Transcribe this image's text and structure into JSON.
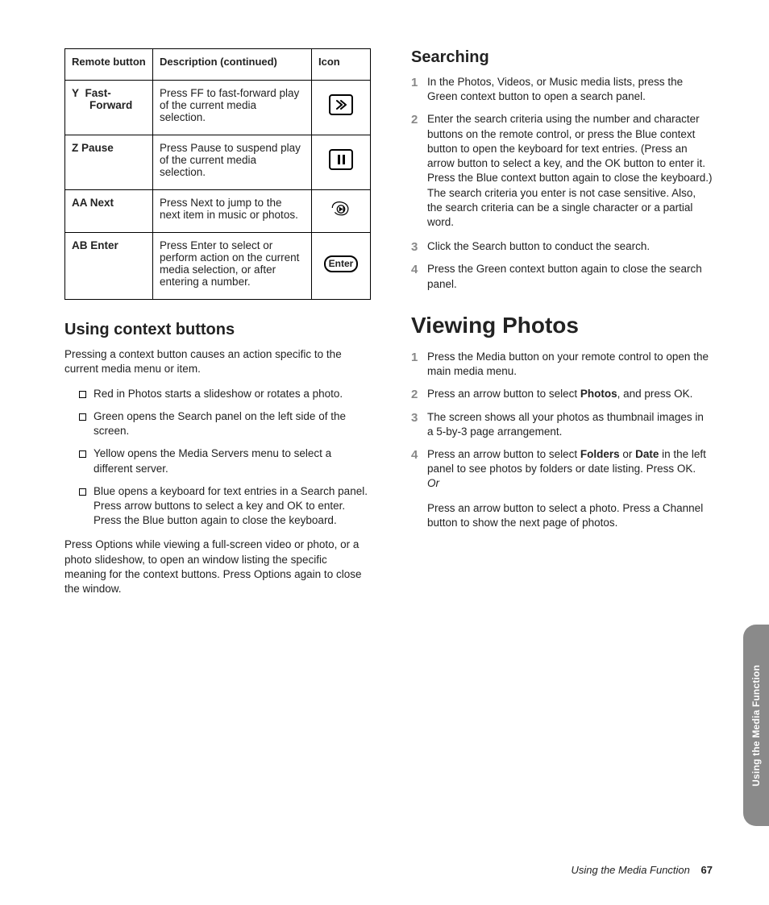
{
  "table": {
    "headers": {
      "col1": "Remote button",
      "col2": "Description (continued)",
      "col3": "Icon"
    },
    "rows": [
      {
        "btn_pre": "Y",
        "btn": "Fast-Forward",
        "desc": "Press FF to fast-forward play of the current media selection.",
        "icon": "ff"
      },
      {
        "btn_pre": "Z",
        "btn": "Pause",
        "desc": "Press Pause to suspend play of the current media selection.",
        "icon": "pause"
      },
      {
        "btn_pre": "AA",
        "btn": "Next",
        "desc": "Press Next to jump to the next item in music or photos.",
        "icon": "next"
      },
      {
        "btn_pre": "AB",
        "btn": "Enter",
        "desc": "Press Enter to select or perform action on the current media selection, or after entering a number.",
        "icon": "enter",
        "icon_label": "Enter"
      }
    ]
  },
  "left": {
    "h_context": "Using context buttons",
    "p_context_intro": "Pressing a context button causes an action specific to the current media menu or item.",
    "context_items": [
      "Red in Photos starts a slideshow or rotates a photo.",
      "Green opens the Search panel on the left side of the screen.",
      "Yellow opens the Media Servers menu to select a different server.",
      "Blue opens a keyboard for text entries in a Search panel. Press arrow buttons to select a key and OK to enter. Press the Blue button again to close the keyboard."
    ],
    "p_context_outro": "Press Options while viewing a full-screen video or photo, or a photo slideshow, to open an window listing the specific meaning for the context buttons. Press Options again to close the window."
  },
  "right": {
    "h_search": "Searching",
    "search_steps": [
      "In the Photos, Videos, or Music media lists, press the Green context button to open a search panel.",
      "Enter the search criteria using the number and character buttons on the remote control, or press the Blue context button to open the keyboard for text entries. (Press an arrow button to select a key, and the OK button to enter it. Press the Blue context button again to close the keyboard.)",
      "Click the Search button to conduct the search.",
      "Press the Green context button again to close the search panel."
    ],
    "search_sub_after_2": "The search criteria you enter is not case sensitive. Also, the search criteria can be a single character or a partial word.",
    "h_viewing": "Viewing Photos",
    "view_steps_1": "Press the Media button on your remote control to open the main media menu.",
    "view_steps_2_a": "Press an arrow button to select ",
    "view_steps_2_b": "Photos",
    "view_steps_2_c": ", and press OK.",
    "view_steps_3": "The screen shows all your photos as thumbnail images in a 5-by-3 page arrangement.",
    "view_steps_4_a": "Press an arrow button to select ",
    "view_steps_4_b": "Folders",
    "view_steps_4_c": " or ",
    "view_steps_4_d": "Date",
    "view_steps_4_e": " in the left panel to see photos by folders or date listing. Press OK.",
    "view_or": "Or",
    "view_alt": "Press an arrow button to select a photo. Press a Channel button to show the next page of photos."
  },
  "sidebar_label": "Using the Media Function",
  "footer_title": "Using the Media Function",
  "footer_page": "67"
}
